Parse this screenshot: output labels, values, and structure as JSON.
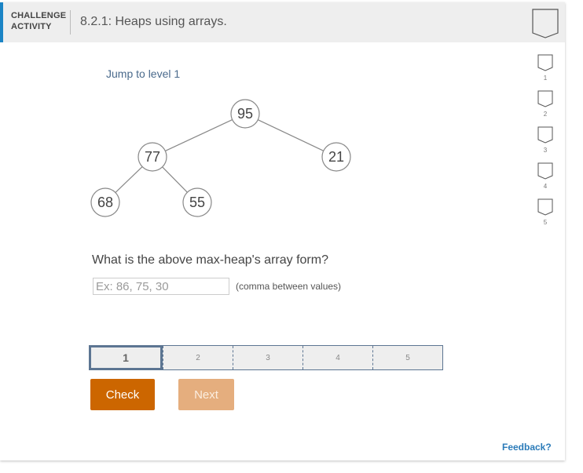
{
  "header": {
    "label_line1": "CHALLENGE",
    "label_line2": "ACTIVITY",
    "title": "8.2.1: Heaps using arrays."
  },
  "jump_link": "Jump to level 1",
  "tree": {
    "nodes": [
      {
        "id": "n95",
        "value": "95"
      },
      {
        "id": "n77",
        "value": "77"
      },
      {
        "id": "n21",
        "value": "21"
      },
      {
        "id": "n68",
        "value": "68"
      },
      {
        "id": "n55",
        "value": "55"
      }
    ],
    "edges": [
      [
        "n95",
        "n77"
      ],
      [
        "n95",
        "n21"
      ],
      [
        "n77",
        "n68"
      ],
      [
        "n77",
        "n55"
      ]
    ]
  },
  "question": "What is the above max-heap's array form?",
  "answer": {
    "value": "",
    "placeholder": "Ex: 86, 75, 30",
    "hint": "(comma between values)"
  },
  "levels": [
    {
      "label": "1",
      "active": true
    },
    {
      "label": "2",
      "active": false
    },
    {
      "label": "3",
      "active": false
    },
    {
      "label": "4",
      "active": false
    },
    {
      "label": "5",
      "active": false
    }
  ],
  "buttons": {
    "check": "Check",
    "next": "Next"
  },
  "side_levels": [
    "1",
    "2",
    "3",
    "4",
    "5"
  ],
  "feedback": "Feedback?",
  "colors": {
    "accent": "#1b84c5",
    "check": "#cc6600",
    "next_disabled": "#e5ae7e",
    "level_border": "#5c7592",
    "link": "#2b7bb9"
  }
}
